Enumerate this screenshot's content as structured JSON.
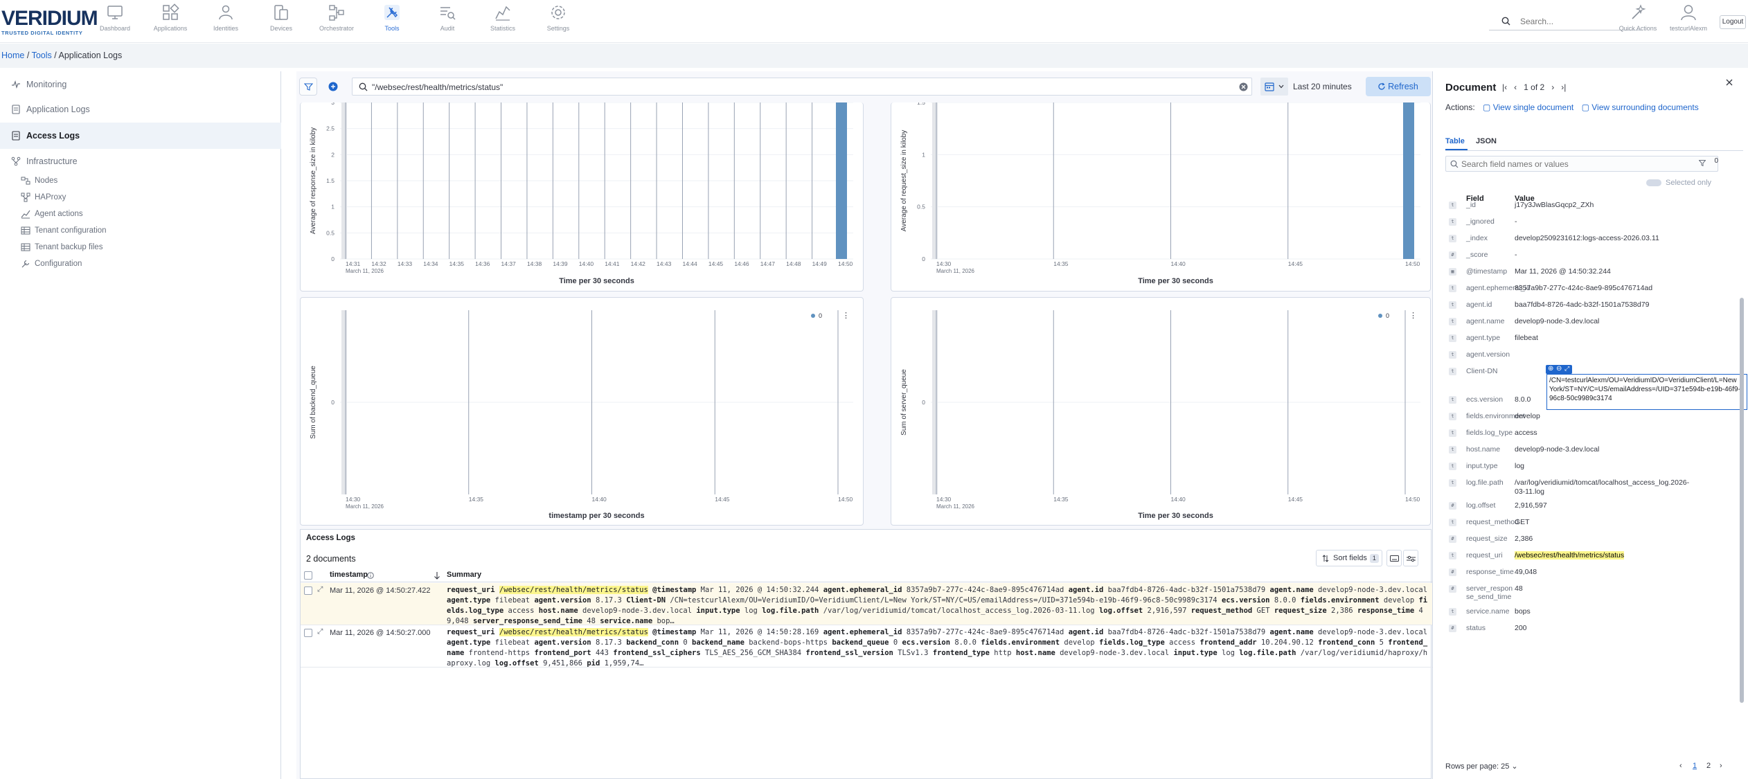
{
  "brand": {
    "name": "VERIDIUM",
    "tagline": "TRUSTED DIGITAL IDENTITY"
  },
  "nav": [
    {
      "label": "Dashboard",
      "icon": "monitor-icon"
    },
    {
      "label": "Applications",
      "icon": "grid-icon"
    },
    {
      "label": "Identities",
      "icon": "users-icon"
    },
    {
      "label": "Devices",
      "icon": "devices-icon"
    },
    {
      "label": "Orchestrator",
      "icon": "flow-icon"
    },
    {
      "label": "Tools",
      "icon": "tools-icon",
      "active": true
    },
    {
      "label": "Audit",
      "icon": "audit-icon"
    },
    {
      "label": "Statistics",
      "icon": "stats-icon"
    },
    {
      "label": "Settings",
      "icon": "gear-icon"
    }
  ],
  "header": {
    "search_placeholder": "Search...",
    "quick_actions": "Quick Actions",
    "user": "testcurlAlexm",
    "logout": "Logout"
  },
  "breadcrumb": [
    "Home",
    "Tools",
    "Application Logs"
  ],
  "sidebar": {
    "items": [
      {
        "label": "Monitoring",
        "icon": "pulse-icon"
      },
      {
        "label": "Application Logs",
        "icon": "doc-icon"
      },
      {
        "label": "Access Logs",
        "icon": "doc-icon",
        "active": true
      },
      {
        "label": "Infrastructure",
        "icon": "hierarchy-icon"
      }
    ],
    "subitems": [
      {
        "label": "Nodes",
        "icon": "nodes-icon"
      },
      {
        "label": "HAProxy",
        "icon": "network-icon"
      },
      {
        "label": "Agent actions",
        "icon": "chart-icon"
      },
      {
        "label": "Tenant configuration",
        "icon": "table-icon"
      },
      {
        "label": "Tenant backup files",
        "icon": "table-icon"
      },
      {
        "label": "Configuration",
        "icon": "wrench-icon"
      }
    ]
  },
  "query": {
    "text": "\"/websec/rest/health/metrics/status\"",
    "range": "Last 20 minutes",
    "refresh": "Refresh"
  },
  "charts": {
    "c1": {
      "ylabel": "Average of response_size in kiloby",
      "xlabel": "Time per 30 seconds",
      "yticks": [
        "0",
        "0.5",
        "1",
        "1.5",
        "2",
        "2.5",
        "3"
      ],
      "xticks": [
        "14:31",
        "14:32",
        "14:33",
        "14:34",
        "14:35",
        "14:36",
        "14:37",
        "14:38",
        "14:39",
        "14:40",
        "14:41",
        "14:42",
        "14:43",
        "14:44",
        "14:45",
        "14:46",
        "14:47",
        "14:48",
        "14:49",
        "14:50"
      ],
      "date": "March 11, 2026"
    },
    "c2": {
      "ylabel": "Average of request_size in kiloby",
      "xlabel": "Time per 30 seconds",
      "yticks": [
        "0",
        "0.5",
        "1",
        "1.5"
      ],
      "xticks": [
        "14:30",
        "14:35",
        "14:40",
        "14:45",
        "14:50"
      ],
      "date": "March 11, 2026"
    },
    "c3": {
      "ylabel": "Sum of backend_queue",
      "xlabel": "timestamp per 30 seconds",
      "ytick": "0",
      "legend": "0",
      "xticks": [
        "14:30",
        "14:35",
        "14:40",
        "14:45",
        "14:50"
      ],
      "date": "March 11, 2026"
    },
    "c4": {
      "ylabel": "Sum of server_queue",
      "xlabel": "Time per 30 seconds",
      "ytick": "0",
      "legend": "0",
      "xticks": [
        "14:30",
        "14:35",
        "14:40",
        "14:45",
        "14:50"
      ],
      "date": "March 11, 2026"
    }
  },
  "logs": {
    "title": "Access Logs",
    "count": "2 documents",
    "sort": "Sort fields",
    "sort_count": "1",
    "col_timestamp": "timestamp",
    "col_summary": "Summary",
    "rows": [
      {
        "timestamp": "Mar 11, 2026 @ 14:50:27.422",
        "highlighted": true,
        "summary": "request_uri /websec/rest/health/metrics/status @timestamp Mar 11, 2026 @ 14:50:32.244 agent.ephemeral_id 8357a9b7-277c-424c-8ae9-895c476714ad agent.id baa7fdb4-8726-4adc-b32f-1501a7538d79 agent.name develop9-node-3.dev.local agent.type filebeat agent.version 8.17.3 Client-DN /CN=testcurlAlexm/OU=VeridiumID/O=VeridiumClient/L=New York/ST=NY/C=US/emailAddress=/UID=371e594b-e19b-46f9-96c8-50c9989c3174 ecs.version 8.0.0 fields.environment develop fields.log_type access host.name develop9-node-3.dev.local input.type log log.file.path /var/log/veridiumid/tomcat/localhost_access_log.2026-03-11.log log.offset 2,916,597 request_method GET request_size 2,386 response_time 49,048 server_response_send_time 48 service.name bop…"
      },
      {
        "timestamp": "Mar 11, 2026 @ 14:50:27.000",
        "highlighted": false,
        "summary": "request_uri /websec/rest/health/metrics/status @timestamp Mar 11, 2026 @ 14:50:28.169 agent.ephemeral_id 8357a9b7-277c-424c-8ae9-895c476714ad agent.id baa7fdb4-8726-4adc-b32f-1501a7538d79 agent.name develop9-node-3.dev.local agent.type filebeat agent.version 8.17.3 backend_conn 0 backend_name backend-bops-https backend_queue 0 ecs.version 8.0.0 fields.environment develop fields.log_type access frontend_addr 10.204.90.12 frontend_conn 5 frontend_name frontend-https frontend_port 443 frontend_ssl_ciphers TLS_AES_256_GCM_SHA384 frontend_ssl_version TLSv1.3 frontend_type http host.name develop9-node-3.dev.local input.type log log.file.path /var/log/veridiumid/haproxy/haproxy.log log.offset 9,451,866 pid 1,959,74…"
      }
    ]
  },
  "document": {
    "title": "Document",
    "pager": "1 of 2",
    "actions_label": "Actions:",
    "view_single": "View single document",
    "view_surrounding": "View surrounding documents",
    "tab_table": "Table",
    "tab_json": "JSON",
    "search_placeholder": "Search field names or values",
    "filter_count": "0",
    "selected_only": "Selected only",
    "col_field": "Field",
    "col_value": "Value",
    "fields": [
      {
        "t": "t",
        "name": "_id",
        "value": "j17y3JwBlasGqcp2_ZXh"
      },
      {
        "t": "t",
        "name": "_ignored",
        "value": "-"
      },
      {
        "t": "t",
        "name": "_index",
        "value": "develop2509231612:logs-access-2026.03.11"
      },
      {
        "t": "#",
        "name": "_score",
        "value": "-"
      },
      {
        "t": "d",
        "name": "@timestamp",
        "value": "Mar 11, 2026 @ 14:50:32.244"
      },
      {
        "t": "t",
        "name": "agent.ephemeral_id",
        "value": "8357a9b7-277c-424c-8ae9-895c476714ad"
      },
      {
        "t": "t",
        "name": "agent.id",
        "value": "baa7fdb4-8726-4adc-b32f-1501a7538d79"
      },
      {
        "t": "t",
        "name": "agent.name",
        "value": "develop9-node-3.dev.local"
      },
      {
        "t": "t",
        "name": "agent.type",
        "value": "filebeat"
      },
      {
        "t": "t",
        "name": "agent.version",
        "value": ""
      },
      {
        "t": "t",
        "name": "Client-DN",
        "value": ""
      },
      {
        "t": "t",
        "name": "ecs.version",
        "value": "8.0.0"
      },
      {
        "t": "t",
        "name": "fields.environment",
        "value": "develop"
      },
      {
        "t": "t",
        "name": "fields.log_type",
        "value": "access"
      },
      {
        "t": "t",
        "name": "host.name",
        "value": "develop9-node-3.dev.local"
      },
      {
        "t": "t",
        "name": "input.type",
        "value": "log"
      },
      {
        "t": "t",
        "name": "log.file.path",
        "value": "/var/log/veridiumid/tomcat/localhost_access_log.2026-03-11.log"
      },
      {
        "t": "#",
        "name": "log.offset",
        "value": "2,916,597"
      },
      {
        "t": "t",
        "name": "request_method",
        "value": "GET"
      },
      {
        "t": "#",
        "name": "request_size",
        "value": "2,386"
      },
      {
        "t": "t",
        "name": "request_uri",
        "value": "/websec/rest/health/metrics/status"
      },
      {
        "t": "#",
        "name": "response_time",
        "value": "49,048"
      },
      {
        "t": "#",
        "name": "server_response_send_time",
        "value": "48"
      },
      {
        "t": "t",
        "name": "service.name",
        "value": "bops"
      },
      {
        "t": "#",
        "name": "status",
        "value": "200"
      }
    ],
    "client_dn_popup": "/CN=testcurlAlexm/OU=VeridiumID/O=VeridiumClient/L=New York/ST=NY/C=US/emailAddress=/UID=371e594b-e19b-46f9-96c8-50c9989c3174",
    "rows_per_page": "Rows per page: 25",
    "pages": [
      "1",
      "2"
    ]
  }
}
